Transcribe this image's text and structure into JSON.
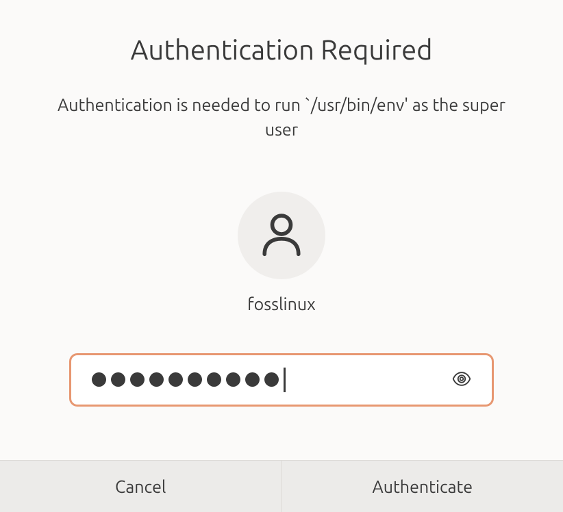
{
  "dialog": {
    "title": "Authentication Required",
    "message": "Authentication is needed to run `/usr/bin/env' as the super user",
    "username": "fosslinux",
    "password_dots_count": 10
  },
  "buttons": {
    "cancel": "Cancel",
    "authenticate": "Authenticate"
  }
}
